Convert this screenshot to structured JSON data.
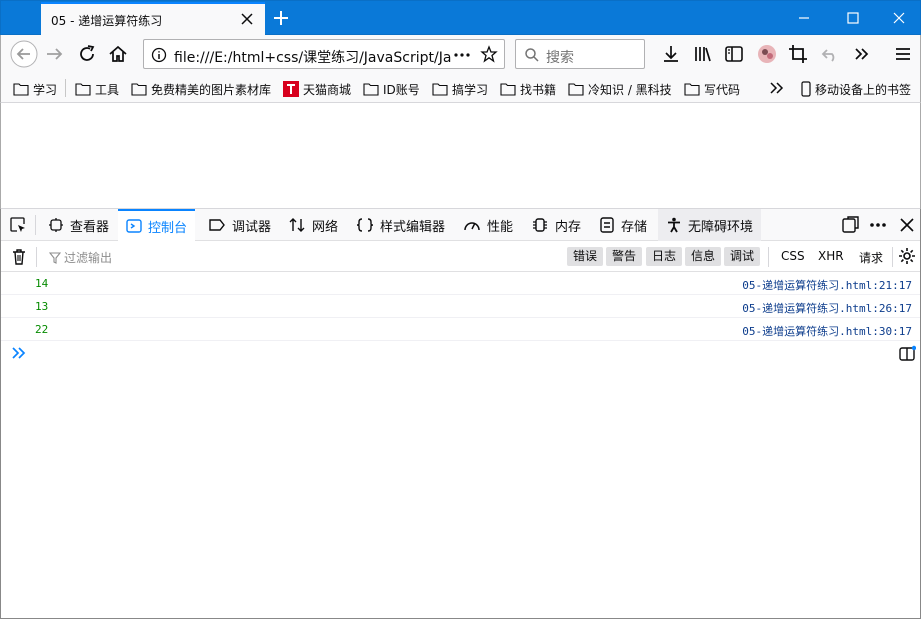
{
  "browser": {
    "tab_title": "05 - 递增运算符练习",
    "url": "file:///E:/html+css/课堂练习/JavaScript/Ja",
    "search_placeholder": "搜索"
  },
  "bookmarks": [
    {
      "label": "学习",
      "icon": "folder-icon"
    },
    {
      "label": "工具",
      "icon": "folder-icon"
    },
    {
      "label": "免费精美的图片素材库",
      "icon": "folder-icon"
    },
    {
      "label": "天猫商城",
      "icon": "tmall-icon"
    },
    {
      "label": "ID账号",
      "icon": "folder-icon"
    },
    {
      "label": "搞学习",
      "icon": "folder-icon"
    },
    {
      "label": "找书籍",
      "icon": "folder-icon"
    },
    {
      "label": "冷知识 / 黑科技",
      "icon": "folder-icon"
    },
    {
      "label": "写代码",
      "icon": "folder-icon"
    }
  ],
  "mobile_bookmarks": "移动设备上的书签",
  "devtools": {
    "tabs": [
      {
        "label": "查看器",
        "icon": "inspector-icon"
      },
      {
        "label": "控制台",
        "icon": "console-icon",
        "active": true
      },
      {
        "label": "调试器",
        "icon": "debugger-icon"
      },
      {
        "label": "网络",
        "icon": "network-icon"
      },
      {
        "label": "样式编辑器",
        "icon": "style-editor-icon"
      },
      {
        "label": "性能",
        "icon": "performance-icon"
      },
      {
        "label": "内存",
        "icon": "memory-icon"
      },
      {
        "label": "存储",
        "icon": "storage-icon"
      },
      {
        "label": "无障碍环境",
        "icon": "accessibility-icon"
      }
    ],
    "filter_placeholder": "过滤输出",
    "level_filters": [
      "错误",
      "警告",
      "日志",
      "信息",
      "调试"
    ],
    "type_filters": [
      "CSS",
      "XHR",
      "请求"
    ],
    "logs": [
      {
        "value": "14",
        "source": "05-递增运算符练习.html:21:17"
      },
      {
        "value": "13",
        "source": "05-递增运算符练习.html:26:17"
      },
      {
        "value": "22",
        "source": "05-递增运算符练习.html:30:17"
      }
    ]
  },
  "colors": {
    "titlebar": "#0a79d8",
    "accent": "#0a84ff",
    "log_value": "#058b00",
    "log_source": "#0c3c8c"
  }
}
